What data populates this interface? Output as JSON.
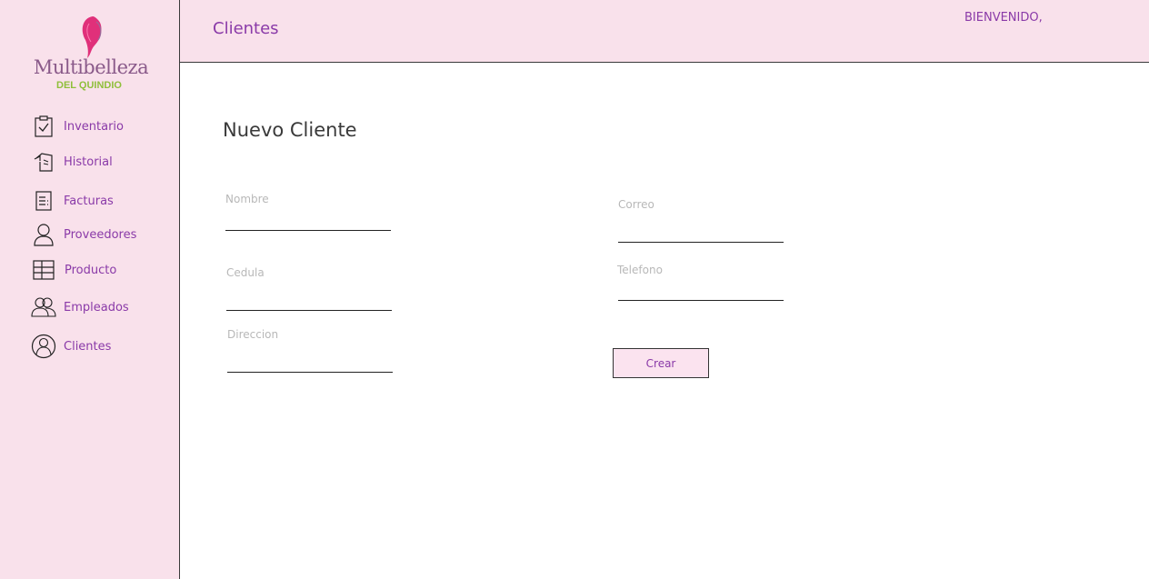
{
  "brand": {
    "name": "Multibelleza",
    "subtitle": "DEL QUINDIO"
  },
  "sidebar": {
    "items": [
      {
        "label": "Inventario",
        "icon": "clipboard-check-icon"
      },
      {
        "label": "Historial",
        "icon": "history-icon"
      },
      {
        "label": "Facturas",
        "icon": "invoice-icon"
      },
      {
        "label": "Proveedores",
        "icon": "person-icon"
      },
      {
        "label": "Producto",
        "icon": "grid-table-icon"
      },
      {
        "label": "Empleados",
        "icon": "people-icon"
      },
      {
        "label": "Clientes",
        "icon": "user-circle-icon"
      }
    ]
  },
  "header": {
    "title": "Clientes",
    "welcome": "BIENVENIDO,"
  },
  "form": {
    "title": "Nuevo Cliente",
    "fields": {
      "nombre": {
        "label": "Nombre",
        "value": ""
      },
      "cedula": {
        "label": "Cedula",
        "value": ""
      },
      "direccion": {
        "label": "Direccion",
        "value": ""
      },
      "correo": {
        "label": "Correo",
        "value": ""
      },
      "telefono": {
        "label": "Telefono",
        "value": ""
      }
    },
    "submit_label": "Crear"
  },
  "colors": {
    "accent": "#8a3aa8",
    "panel_bg": "#f9e1eb",
    "brand_green": "#8fbf3a",
    "brand_pink": "#e0307a"
  }
}
